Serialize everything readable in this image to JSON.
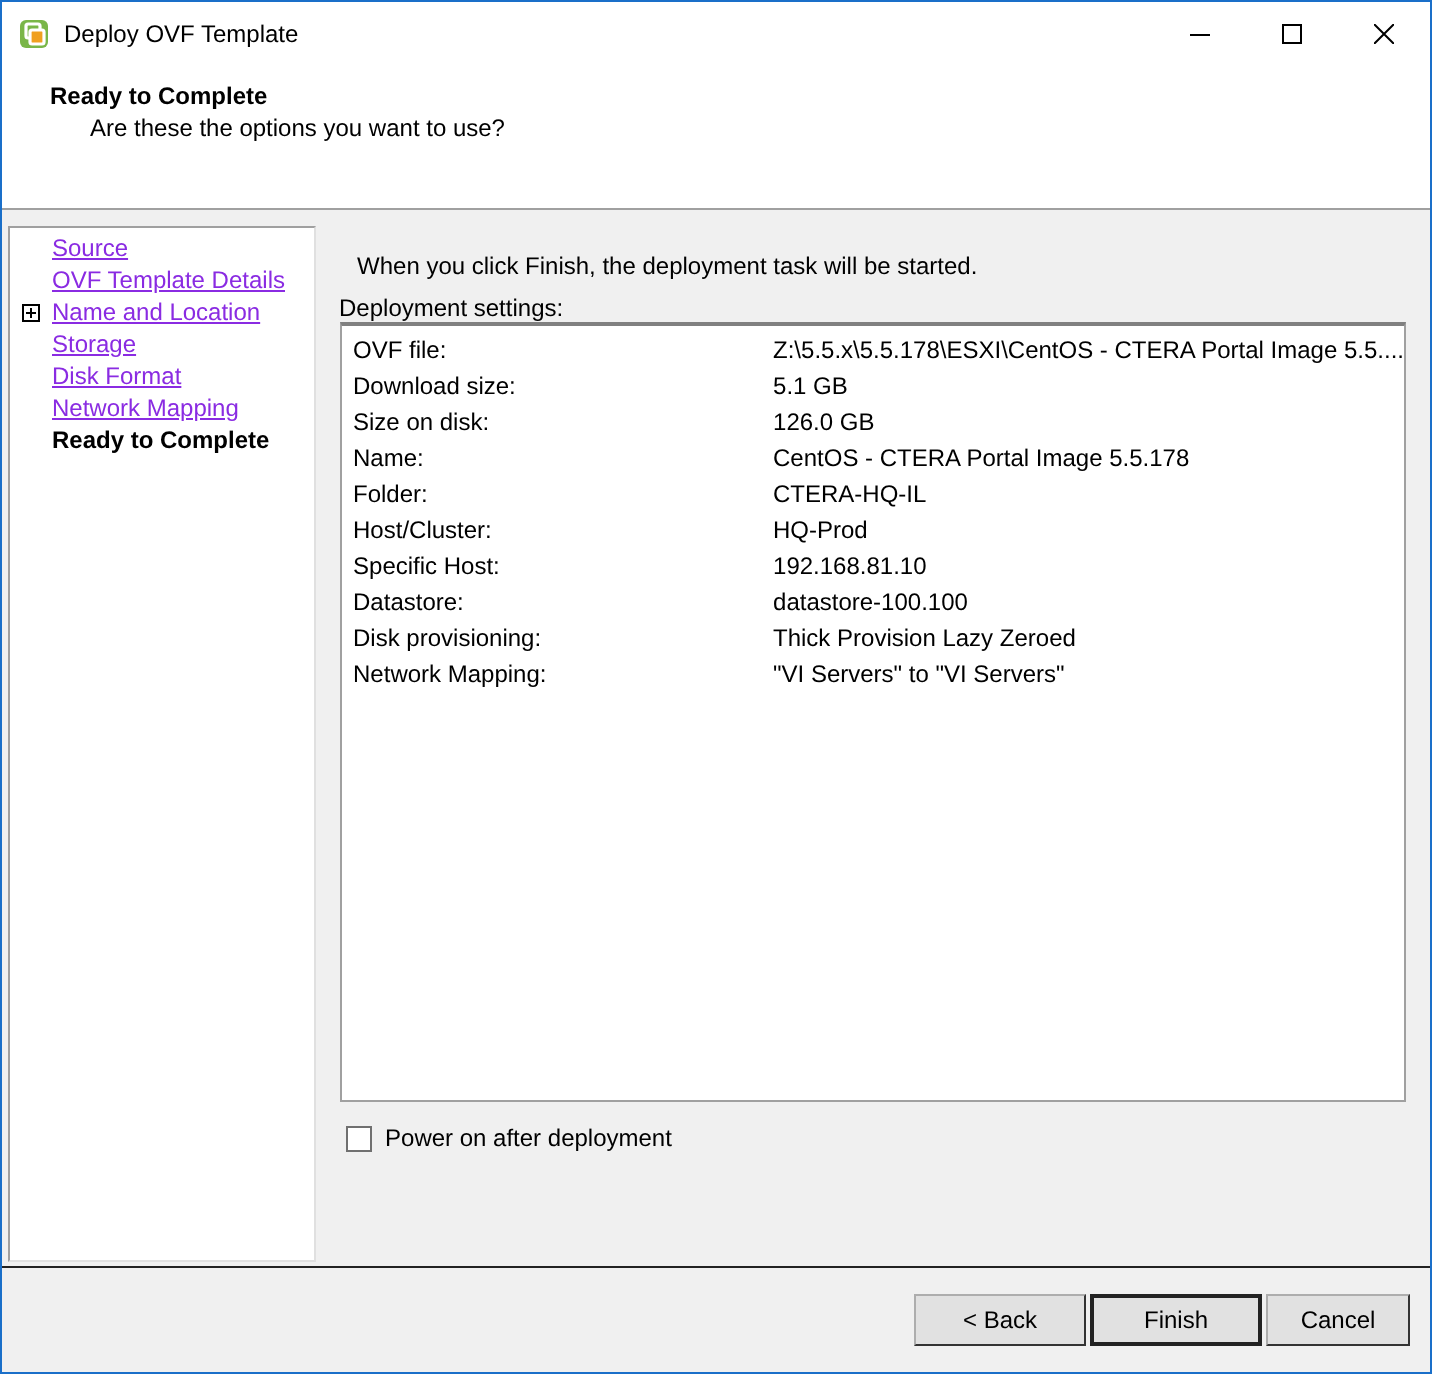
{
  "window": {
    "title": "Deploy OVF Template"
  },
  "header": {
    "title": "Ready to Complete",
    "subtitle": "Are these the options you want to use?"
  },
  "steps": [
    {
      "label": "Source",
      "selected": false,
      "kind": "plain"
    },
    {
      "label": "OVF Template Details",
      "selected": false,
      "kind": "plain"
    },
    {
      "label": "Name and Location",
      "selected": false,
      "kind": "expandable"
    },
    {
      "label": "Storage",
      "selected": false,
      "kind": "plain"
    },
    {
      "label": "Disk Format",
      "selected": false,
      "kind": "plain"
    },
    {
      "label": "Network Mapping",
      "selected": false,
      "kind": "plain"
    },
    {
      "label": "Ready to Complete",
      "selected": true,
      "kind": "plain"
    }
  ],
  "intro": "When you click Finish, the deployment task will be started.",
  "settings": {
    "label": "Deployment settings:",
    "rows": [
      {
        "name": "OVF file:",
        "value": "Z:\\5.5.x\\5.5.178\\ESXI\\CentOS - CTERA Portal Image 5.5...."
      },
      {
        "name": "Download size:",
        "value": "5.1 GB"
      },
      {
        "name": "Size on disk:",
        "value": "126.0 GB"
      },
      {
        "name": "Name:",
        "value": "CentOS - CTERA Portal Image 5.5.178"
      },
      {
        "name": "Folder:",
        "value": "CTERA-HQ-IL"
      },
      {
        "name": "Host/Cluster:",
        "value": "HQ-Prod"
      },
      {
        "name": "Specific Host:",
        "value": "192.168.81.10"
      },
      {
        "name": "Datastore:",
        "value": "datastore-100.100"
      },
      {
        "name": "Disk provisioning:",
        "value": "Thick Provision Lazy Zeroed"
      },
      {
        "name": "Network Mapping:",
        "value": "\"VI Servers\" to \"VI Servers\""
      }
    ]
  },
  "power_on": {
    "label": "Power on after deployment",
    "checked": false
  },
  "buttons": [
    {
      "label": "< Back",
      "default": false
    },
    {
      "label": "Finish",
      "default": true
    },
    {
      "label": "Cancel",
      "default": false
    }
  ]
}
